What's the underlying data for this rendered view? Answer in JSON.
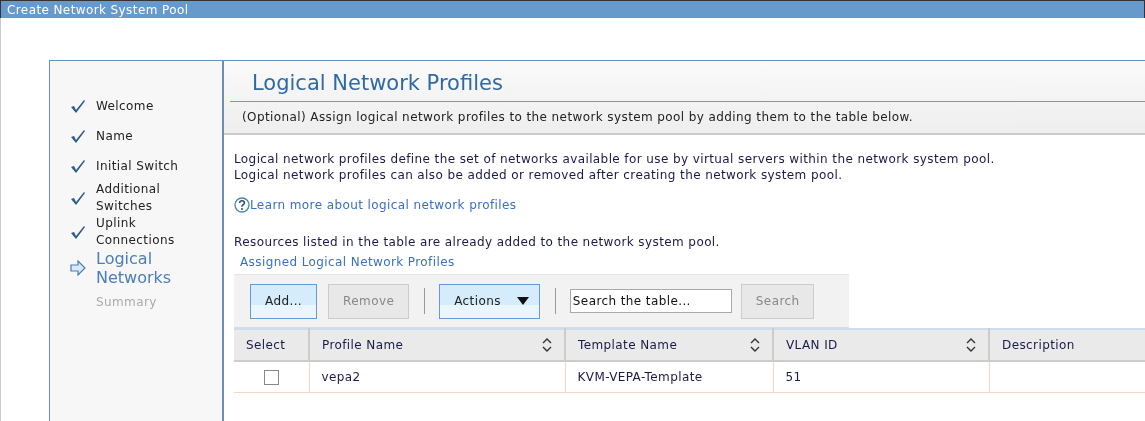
{
  "window": {
    "title": "Create Network System Pool"
  },
  "steps": [
    {
      "label": "Welcome",
      "kind": "done"
    },
    {
      "label": "Name",
      "kind": "done"
    },
    {
      "label": "Initial Switch",
      "kind": "done"
    },
    {
      "label": "Additional Switches",
      "kind": "done"
    },
    {
      "label": "Uplink Connections",
      "kind": "done"
    },
    {
      "label": "Logical Networks",
      "kind": "current"
    },
    {
      "label": "Summary",
      "kind": "pending"
    }
  ],
  "page": {
    "heading": "Logical Network Profiles",
    "instruction": "(Optional) Assign logical network profiles to the network system pool by adding them to the table below.",
    "description": [
      "Logical network profiles define the set of networks available for use by virtual servers within the network system pool.",
      "Logical network profiles can also be added or removed after creating the network system pool."
    ],
    "help_link": "Learn more about logical network profiles",
    "note": "Resources listed in the table are already added to the network system pool.",
    "table_title": "Assigned Logical Network Profiles"
  },
  "toolbar": {
    "add": "Add...",
    "remove": "Remove",
    "remove_disabled": true,
    "actions": "Actions",
    "search_placeholder": "Search the table...",
    "search": "Search"
  },
  "table": {
    "columns": [
      {
        "label": "Select"
      },
      {
        "label": "Profile Name",
        "sortable": true
      },
      {
        "label": "Template Name",
        "sortable": true
      },
      {
        "label": "VLAN ID",
        "sortable": true
      },
      {
        "label": "Description"
      }
    ],
    "rows": [
      {
        "checked": false,
        "cells": [
          "",
          "vepa2",
          "KVM-VEPA-Template",
          "51"
        ]
      }
    ]
  }
}
